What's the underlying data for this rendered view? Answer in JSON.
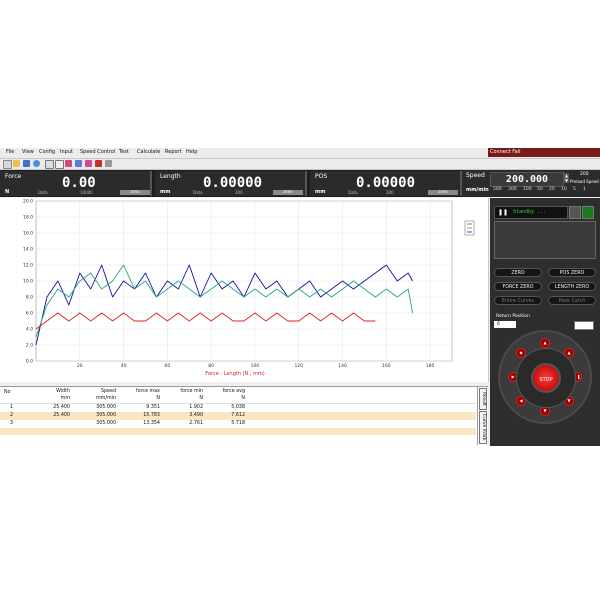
{
  "menu": [
    "File",
    "View",
    "Config",
    "Input",
    "Speed Control",
    "Test",
    "Calculate",
    "Report",
    "Help"
  ],
  "status_text": "Connect Fail",
  "readouts": {
    "force": {
      "title": "Force",
      "value": "0.00",
      "unit": "N",
      "data_label": "Data",
      "data_value": "10000",
      "zero_label": "ZERO"
    },
    "length": {
      "title": "Length",
      "value": "0.00000",
      "unit": "mm",
      "data_label": "Data",
      "data_value": "300",
      "zero_label": "ZERO"
    },
    "pos": {
      "title": "POS",
      "value": "0.00000",
      "unit": "mm",
      "data_label": "Data",
      "data_value": "300",
      "zero_label": "ZERO"
    },
    "speed": {
      "title": "Speed",
      "value": "200.000",
      "unit": "mm/min",
      "side_value": "200",
      "side_label": "Preload Speed",
      "options": [
        "500",
        "300",
        "100",
        "50",
        "20",
        "10",
        "5",
        "1"
      ]
    }
  },
  "chart_data": {
    "type": "line",
    "xlabel": "Force - Length  (N , mm)",
    "xlim": [
      0,
      190
    ],
    "ylim": [
      0,
      20
    ],
    "xticks": [
      20,
      40,
      60,
      80,
      100,
      120,
      140,
      160,
      180
    ],
    "yticks": [
      "0.0",
      "2.0",
      "4.0",
      "6.0",
      "8.0",
      "10.0",
      "12.0",
      "14.0",
      "16.0",
      "18.0",
      "20.0"
    ],
    "grid": true,
    "series": [
      {
        "color": "#1010a8",
        "x": [
          0,
          5,
          10,
          15,
          20,
          25,
          30,
          35,
          40,
          45,
          50,
          55,
          60,
          65,
          70,
          75,
          80,
          85,
          90,
          95,
          100,
          105,
          110,
          115,
          120,
          125,
          130,
          135,
          140,
          145,
          150,
          155,
          160,
          165,
          170,
          172
        ],
        "values": [
          2,
          8,
          10,
          7,
          11,
          9,
          12,
          8,
          10,
          9,
          11,
          8,
          10,
          9,
          12,
          8,
          11,
          9,
          10,
          8,
          11,
          9,
          10,
          8,
          9,
          10,
          8,
          9,
          10,
          9,
          10,
          11,
          12,
          10,
          11,
          10
        ]
      },
      {
        "color": "#2aa77a",
        "x": [
          0,
          5,
          10,
          15,
          20,
          25,
          30,
          35,
          40,
          45,
          50,
          55,
          60,
          65,
          70,
          75,
          80,
          85,
          90,
          95,
          100,
          105,
          110,
          115,
          120,
          125,
          130,
          135,
          140,
          145,
          150,
          155,
          160,
          165,
          170,
          172
        ],
        "values": [
          3,
          7,
          9,
          8,
          10,
          11,
          9,
          10,
          12,
          9,
          10,
          8,
          9,
          10,
          9,
          8,
          9,
          10,
          9,
          8,
          9,
          8,
          9,
          8,
          9,
          8,
          9,
          8,
          9,
          10,
          9,
          8,
          9,
          8,
          9,
          6
        ]
      },
      {
        "color": "#e02020",
        "x": [
          0,
          5,
          10,
          15,
          20,
          25,
          30,
          35,
          40,
          45,
          50,
          55,
          60,
          65,
          70,
          75,
          80,
          85,
          90,
          95,
          100,
          105,
          110,
          115,
          120,
          125,
          130,
          135,
          140,
          145,
          150,
          155
        ],
        "values": [
          4,
          5,
          6,
          5,
          6,
          5,
          6,
          5,
          6,
          5,
          5,
          6,
          5,
          6,
          5,
          6,
          5,
          6,
          5,
          5,
          6,
          5,
          6,
          5,
          5,
          6,
          5,
          6,
          5,
          6,
          5,
          5
        ]
      }
    ],
    "legend_icon": "curve-legend-icon"
  },
  "table": {
    "headers": [
      [
        "No",
        ""
      ],
      [
        "Width",
        "mm"
      ],
      [
        "Speed",
        "mm/min"
      ],
      [
        "force max",
        "N"
      ],
      [
        "force min",
        "N"
      ],
      [
        "force avg",
        "N"
      ]
    ],
    "rows": [
      [
        "1",
        "25.400",
        "305.000",
        "9.351",
        "1.902",
        "5.038"
      ],
      [
        "2",
        "25.400",
        "305.000",
        "15.783",
        "3.490",
        "7.612"
      ],
      [
        "3",
        "",
        "305.000",
        "13.354",
        "2.761",
        "5.718"
      ]
    ],
    "side_tabs": [
      "Result",
      "Curve mark"
    ]
  },
  "control": {
    "standby_text": "Standby ...",
    "buttons": [
      "ZERO",
      "POS ZERO",
      "FORCE ZERO",
      "LENGTH ZERO",
      "Entire Curves",
      "Peak Catch"
    ],
    "return_position_label": "Return Position",
    "return_value": "6",
    "stop_label": "STOP"
  }
}
